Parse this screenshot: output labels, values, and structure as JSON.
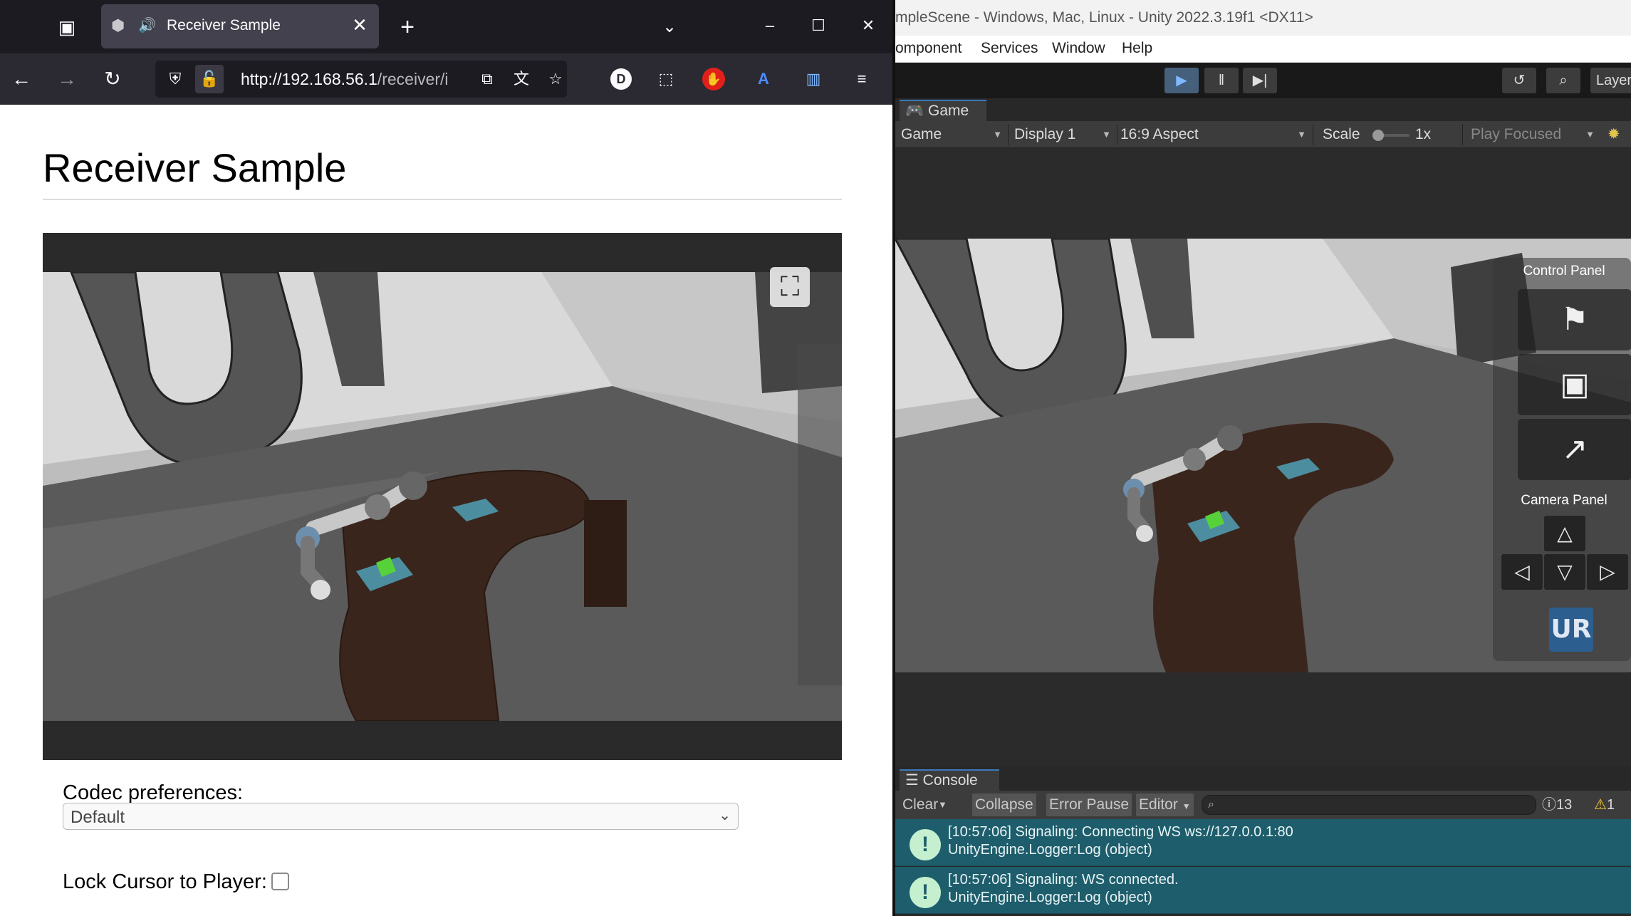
{
  "browser": {
    "tab_title": "Receiver Sample",
    "url_host": "http://192.168.56.1",
    "url_path": "/receiver/i",
    "page_title": "Receiver Sample",
    "codec_label": "Codec preferences:",
    "codec_value": "Default",
    "lock_label": "Lock Cursor to Player:",
    "lock_checked": false,
    "icons": {
      "tab_list": "tab-list-icon",
      "tab_favicon": "unity-icon",
      "tab_audio": "speaker-icon",
      "tab_close": "close-icon",
      "new_tab": "plus-icon",
      "all_tabs": "chevron-down-icon",
      "back": "arrow-left-icon",
      "forward": "arrow-right-icon",
      "reload": "reload-icon",
      "shield": "shield-icon",
      "insecure": "insecure-lock-icon",
      "pip": "picture-in-picture-icon",
      "translate": "translate-icon",
      "bookmark": "star-icon",
      "extensions": "puzzle-icon",
      "menu": "hamburger-icon"
    },
    "extension_letter": "D",
    "translate_ext_label": "A"
  },
  "unity": {
    "title": "mpleScene - Windows, Mac, Linux - Unity 2022.3.19f1 <DX11>",
    "menus": [
      "omponent",
      "Services",
      "Window",
      "Help"
    ],
    "toolbar_layers": "Layer",
    "game_tab": "Game",
    "game_dropdown": "Game",
    "display_dropdown": "Display 1",
    "aspect_dropdown": "16:9 Aspect",
    "scale_label": "Scale",
    "scale_value": "1x",
    "scale_level": 0.0,
    "play_focused": "Play Focused",
    "control_panel_title": "Control Panel",
    "camera_panel_title": "Camera Panel",
    "ur_logo_text": "UR",
    "console": {
      "tab": "Console",
      "clear": "Clear",
      "collapse": "Collapse",
      "error_pause": "Error Pause",
      "editor": "Editor",
      "info_count": "13",
      "warn_count": "1",
      "logs": [
        {
          "line1": "[10:57:06] Signaling: Connecting WS ws://127.0.0.1:80",
          "line2": "UnityEngine.Logger:Log (object)"
        },
        {
          "line1": "[10:57:06] Signaling: WS connected.",
          "line2": "UnityEngine.Logger:Log (object)"
        }
      ]
    },
    "colors": {
      "accent": "#3a79bb",
      "log_bg": "#1e5d6b",
      "play_active": "#46607c"
    }
  }
}
